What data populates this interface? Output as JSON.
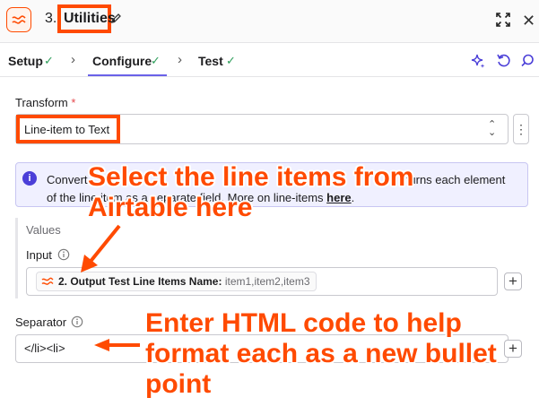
{
  "header": {
    "step_number": "3.",
    "title": "Utilities",
    "icons": [
      "app-icon",
      "pencil-icon",
      "expand-icon",
      "close-icon"
    ]
  },
  "tabs": [
    {
      "label": "Setup",
      "done": true
    },
    {
      "label": "Configure",
      "done": true,
      "active": true
    },
    {
      "label": "Test",
      "done": true
    }
  ],
  "toolbar_icons": [
    "sparkle-icon",
    "undo-icon",
    "search-icon"
  ],
  "transform": {
    "label": "Transform",
    "required_mark": "*",
    "value": "Line-item to Text"
  },
  "info": {
    "text_before": "Convert",
    "text_mid": "turns each element",
    "text_line2": "of the line item as a separate field. More on line-items",
    "link_text": "here",
    "text_end": "."
  },
  "values": {
    "title": "Values",
    "input_label": "Input",
    "pill_name": "2. Output Test Line Items Name:",
    "pill_value": "item1,item2,item3"
  },
  "separator": {
    "label": "Separator",
    "value": "</li><li>"
  },
  "annotations": {
    "select_items_line1": "Select the line items  from",
    "select_items_line2": "Airtable here",
    "html_line1": "Enter HTML code to help",
    "html_line2": "format each as a new bullet",
    "html_line3": "point"
  },
  "colors": {
    "accent": "#ff4a00",
    "check": "#2e9e5b",
    "tab_underline": "#6a62e8",
    "info_bg": "#f0f0ff",
    "info_icon": "#4b3fd8"
  }
}
